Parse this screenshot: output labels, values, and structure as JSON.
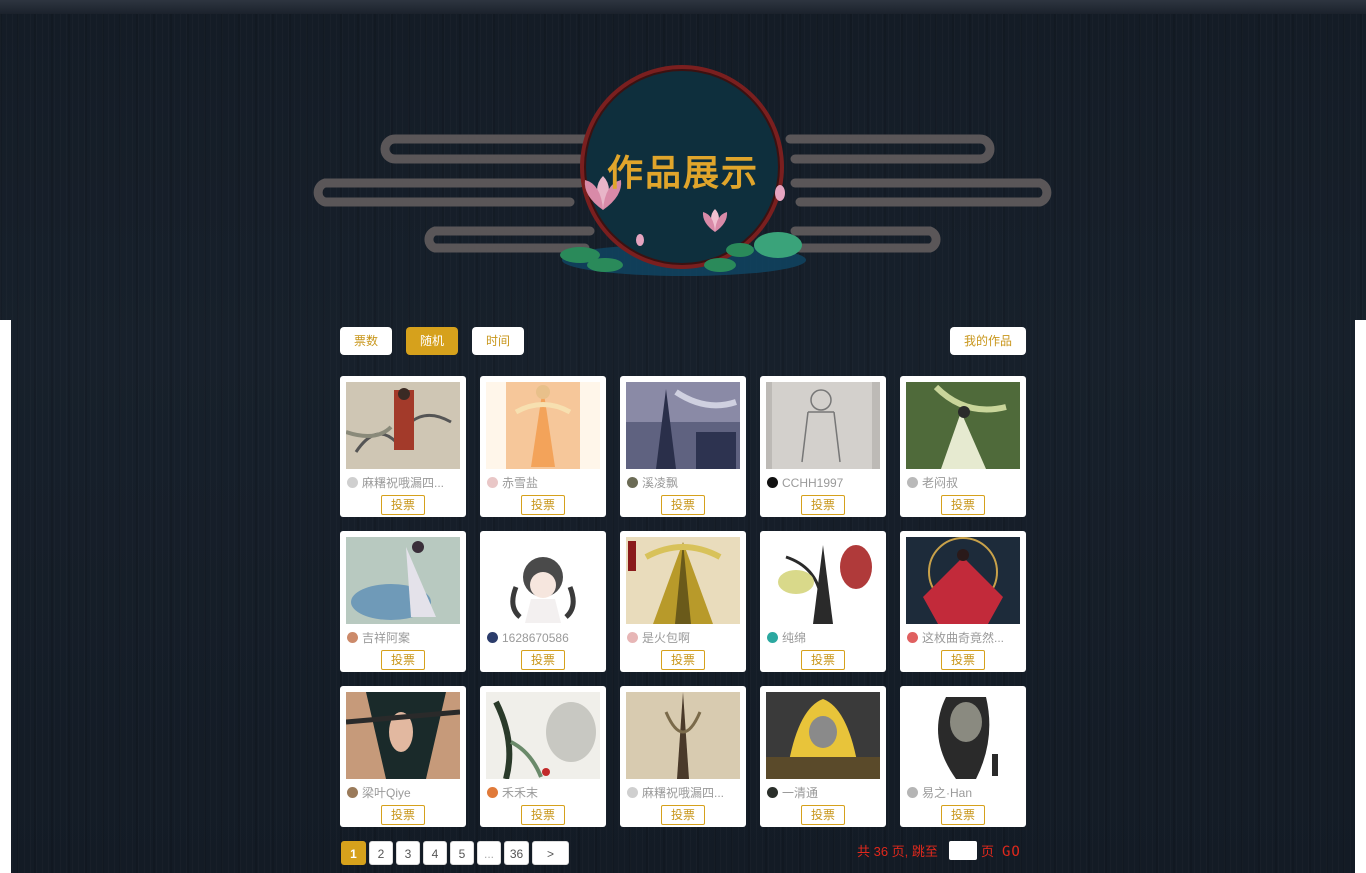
{
  "header": {
    "title": "作品展示"
  },
  "filters": [
    {
      "label": "票数",
      "active": false
    },
    {
      "label": "随机",
      "active": true
    },
    {
      "label": "时间",
      "active": false
    }
  ],
  "my_works_label": "我的作品",
  "vote_label": "投票",
  "works": [
    {
      "author": "麻糬祝哦漏四...",
      "avatar_color": "#cfcfcf"
    },
    {
      "author": "赤雪盐",
      "avatar_color": "#e9c7c7"
    },
    {
      "author": "溪凌飘",
      "avatar_color": "#6b6b55"
    },
    {
      "author": "CCHH1997",
      "avatar_color": "#111111"
    },
    {
      "author": "老闷叔",
      "avatar_color": "#b9b9b9"
    },
    {
      "author": "吉祥阿案",
      "avatar_color": "#cc8a6a"
    },
    {
      "author": "1628670586",
      "avatar_color": "#2b3c6b"
    },
    {
      "author": "是火包啊",
      "avatar_color": "#e7b6b6"
    },
    {
      "author": "纯绵",
      "avatar_color": "#2ba8a0"
    },
    {
      "author": "这枚曲奇竟然...",
      "avatar_color": "#e06060"
    },
    {
      "author": "梁叶Qiye",
      "avatar_color": "#9a7a5a"
    },
    {
      "author": "禾禾末",
      "avatar_color": "#e07a3a"
    },
    {
      "author": "麻糬祝哦漏四...",
      "avatar_color": "#cfcfcf"
    },
    {
      "author": "一清通",
      "avatar_color": "#2a2f2a"
    },
    {
      "author": "易之·Han",
      "avatar_color": "#b5b5b5"
    }
  ],
  "pagination": {
    "pages": [
      "1",
      "2",
      "3",
      "4",
      "5",
      "...",
      "36"
    ],
    "current": "1",
    "next_label": ">",
    "total_prefix": "共 36 页, 跳至",
    "total_suffix": "页",
    "go_label": "GO"
  }
}
